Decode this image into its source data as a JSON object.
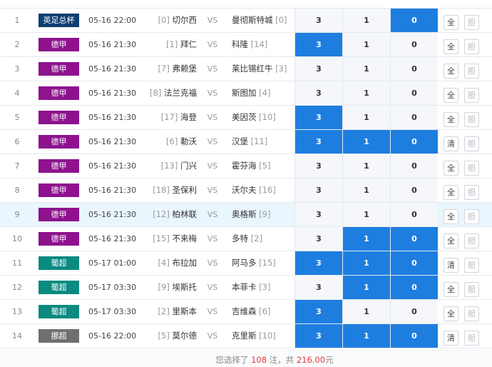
{
  "colors": {
    "selected_blue": "#1e7ee0",
    "league_英足总杯": "#0d3f73",
    "league_德甲": "#8e128e",
    "league_葡超": "#0a8a80",
    "league_挪超": "#6f6f6f",
    "summary_highlight": "#e4393c"
  },
  "matches": [
    {
      "idx": "1",
      "league": "英足总杯",
      "league_color": "#0d3f73",
      "time": "05-16 22:00",
      "home_rank": "[0]",
      "home": "切尔西",
      "vs": "VS",
      "away": "曼彻斯特城",
      "away_rank": "[0]",
      "odds": [
        "3",
        "1",
        "0"
      ],
      "selected": [
        false,
        false,
        true
      ],
      "btn1": "全",
      "btn2": "胆",
      "highlight": false
    },
    {
      "idx": "2",
      "league": "德甲",
      "league_color": "#8e128e",
      "time": "05-16 21:30",
      "home_rank": "[1]",
      "home": "拜仁",
      "vs": "VS",
      "away": "科隆",
      "away_rank": "[14]",
      "odds": [
        "3",
        "1",
        "0"
      ],
      "selected": [
        true,
        false,
        false
      ],
      "btn1": "全",
      "btn2": "胆",
      "highlight": false
    },
    {
      "idx": "3",
      "league": "德甲",
      "league_color": "#8e128e",
      "time": "05-16 21:30",
      "home_rank": "[7]",
      "home": "弗赖堡",
      "vs": "VS",
      "away": "莱比锡红牛",
      "away_rank": "[3]",
      "odds": [
        "3",
        "1",
        "0"
      ],
      "selected": [
        false,
        false,
        false
      ],
      "btn1": "全",
      "btn2": "胆",
      "highlight": false
    },
    {
      "idx": "4",
      "league": "德甲",
      "league_color": "#8e128e",
      "time": "05-16 21:30",
      "home_rank": "[8]",
      "home": "法兰克福",
      "vs": "VS",
      "away": "斯图加",
      "away_rank": "[4]",
      "odds": [
        "3",
        "1",
        "0"
      ],
      "selected": [
        false,
        false,
        false
      ],
      "btn1": "全",
      "btn2": "胆",
      "highlight": false
    },
    {
      "idx": "5",
      "league": "德甲",
      "league_color": "#8e128e",
      "time": "05-16 21:30",
      "home_rank": "[17]",
      "home": "海登",
      "vs": "VS",
      "away": "美因茨",
      "away_rank": "[10]",
      "odds": [
        "3",
        "1",
        "0"
      ],
      "selected": [
        true,
        false,
        false
      ],
      "btn1": "全",
      "btn2": "胆",
      "highlight": false
    },
    {
      "idx": "6",
      "league": "德甲",
      "league_color": "#8e128e",
      "time": "05-16 21:30",
      "home_rank": "[6]",
      "home": "勒沃",
      "vs": "VS",
      "away": "汉堡",
      "away_rank": "[11]",
      "odds": [
        "3",
        "1",
        "0"
      ],
      "selected": [
        true,
        true,
        true
      ],
      "btn1": "清",
      "btn2": "胆",
      "highlight": false
    },
    {
      "idx": "7",
      "league": "德甲",
      "league_color": "#8e128e",
      "time": "05-16 21:30",
      "home_rank": "[13]",
      "home": "门兴",
      "vs": "VS",
      "away": "霍芬海",
      "away_rank": "[5]",
      "odds": [
        "3",
        "1",
        "0"
      ],
      "selected": [
        false,
        false,
        false
      ],
      "btn1": "全",
      "btn2": "胆",
      "highlight": false
    },
    {
      "idx": "8",
      "league": "德甲",
      "league_color": "#8e128e",
      "time": "05-16 21:30",
      "home_rank": "[18]",
      "home": "圣保利",
      "vs": "VS",
      "away": "沃尔夫",
      "away_rank": "[16]",
      "odds": [
        "3",
        "1",
        "0"
      ],
      "selected": [
        false,
        false,
        false
      ],
      "btn1": "全",
      "btn2": "胆",
      "highlight": false
    },
    {
      "idx": "9",
      "league": "德甲",
      "league_color": "#8e128e",
      "time": "05-16 21:30",
      "home_rank": "[12]",
      "home": "柏林联",
      "vs": "VS",
      "away": "奥格斯",
      "away_rank": "[9]",
      "odds": [
        "3",
        "1",
        "0"
      ],
      "selected": [
        false,
        false,
        false
      ],
      "btn1": "全",
      "btn2": "胆",
      "highlight": true
    },
    {
      "idx": "10",
      "league": "德甲",
      "league_color": "#8e128e",
      "time": "05-16 21:30",
      "home_rank": "[15]",
      "home": "不来梅",
      "vs": "VS",
      "away": "多特",
      "away_rank": "[2]",
      "odds": [
        "3",
        "1",
        "0"
      ],
      "selected": [
        false,
        true,
        true
      ],
      "btn1": "全",
      "btn2": "胆",
      "highlight": false
    },
    {
      "idx": "11",
      "league": "葡超",
      "league_color": "#0a8a80",
      "time": "05-17 01:00",
      "home_rank": "[4]",
      "home": "布拉加",
      "vs": "VS",
      "away": "阿马多",
      "away_rank": "[15]",
      "odds": [
        "3",
        "1",
        "0"
      ],
      "selected": [
        true,
        true,
        true
      ],
      "btn1": "清",
      "btn2": "胆",
      "highlight": false
    },
    {
      "idx": "12",
      "league": "葡超",
      "league_color": "#0a8a80",
      "time": "05-17 03:30",
      "home_rank": "[9]",
      "home": "埃斯托",
      "vs": "VS",
      "away": "本菲卡",
      "away_rank": "[3]",
      "odds": [
        "3",
        "1",
        "0"
      ],
      "selected": [
        false,
        true,
        true
      ],
      "btn1": "全",
      "btn2": "胆",
      "highlight": false
    },
    {
      "idx": "13",
      "league": "葡超",
      "league_color": "#0a8a80",
      "time": "05-17 03:30",
      "home_rank": "[2]",
      "home": "里斯本",
      "vs": "VS",
      "away": "吉维森",
      "away_rank": "[6]",
      "odds": [
        "3",
        "1",
        "0"
      ],
      "selected": [
        true,
        false,
        false
      ],
      "btn1": "全",
      "btn2": "胆",
      "highlight": false
    },
    {
      "idx": "14",
      "league": "挪超",
      "league_color": "#6f6f6f",
      "time": "05-16 22:00",
      "home_rank": "[5]",
      "home": "莫尔德",
      "vs": "VS",
      "away": "克里斯",
      "away_rank": "[10]",
      "odds": [
        "3",
        "1",
        "0"
      ],
      "selected": [
        true,
        true,
        true
      ],
      "btn1": "清",
      "btn2": "胆",
      "highlight": false
    }
  ],
  "summary": {
    "prefix": "您选择了",
    "count": "108",
    "mid": "注，共",
    "amount": "216.00",
    "suffix": "元"
  }
}
